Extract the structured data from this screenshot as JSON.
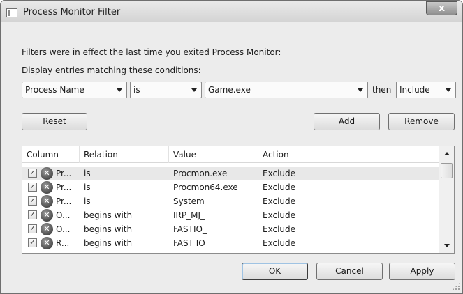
{
  "window": {
    "title": "Process Monitor Filter",
    "close_label": "x"
  },
  "messages": {
    "in_effect": "Filters were in effect the last time you exited Process Monitor:",
    "display_entries": "Display entries matching these conditions:"
  },
  "condition": {
    "column": "Process Name",
    "relation": "is",
    "value": "Game.exe",
    "then_label": "then",
    "action": "Include"
  },
  "buttons": {
    "reset": "Reset",
    "add": "Add",
    "remove": "Remove",
    "ok": "OK",
    "cancel": "Cancel",
    "apply": "Apply"
  },
  "table": {
    "columns": [
      "Column",
      "Relation",
      "Value",
      "Action"
    ],
    "rows": [
      {
        "column": "Pr...",
        "relation": "is",
        "value": "Procmon.exe",
        "action": "Exclude",
        "checked": true,
        "selected": true
      },
      {
        "column": "Pr...",
        "relation": "is",
        "value": "Procmon64.exe",
        "action": "Exclude",
        "checked": true,
        "selected": false
      },
      {
        "column": "Pr...",
        "relation": "is",
        "value": "System",
        "action": "Exclude",
        "checked": true,
        "selected": false
      },
      {
        "column": "O...",
        "relation": "begins with",
        "value": "IRP_MJ_",
        "action": "Exclude",
        "checked": true,
        "selected": false
      },
      {
        "column": "O...",
        "relation": "begins with",
        "value": "FASTIO_",
        "action": "Exclude",
        "checked": true,
        "selected": false
      },
      {
        "column": "R...",
        "relation": "begins with",
        "value": "FAST IO",
        "action": "Exclude",
        "checked": true,
        "selected": false
      }
    ]
  },
  "icons": {
    "app": "process-monitor-app-icon",
    "row_action": "exclude-x-icon",
    "checkbox": "checkbox-checked-icon"
  },
  "colors": {
    "window_bg": "#ececec",
    "selected_row": "#e8e8e8"
  }
}
